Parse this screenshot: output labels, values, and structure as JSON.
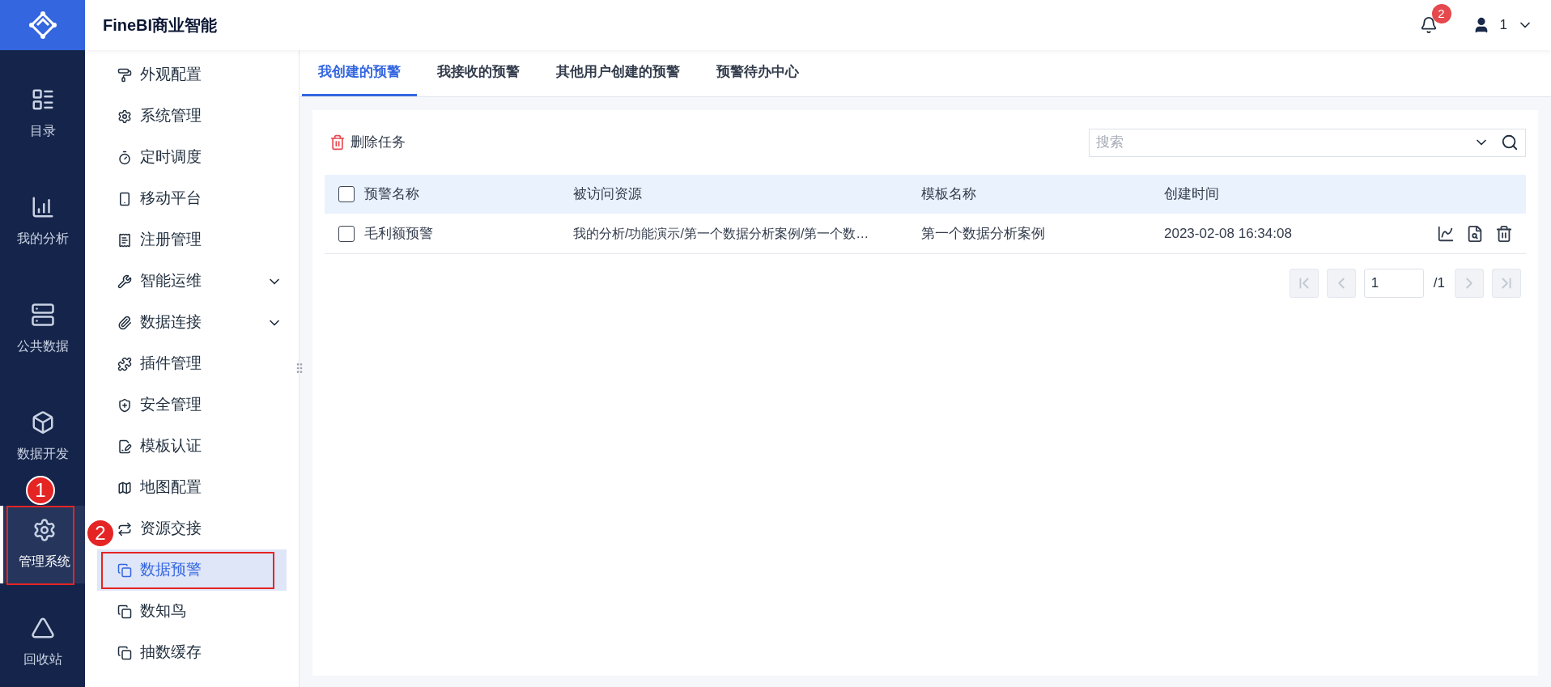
{
  "rail": {
    "items": [
      {
        "label": "目录",
        "selected": false
      },
      {
        "label": "我的分析",
        "selected": false
      },
      {
        "label": "公共数据",
        "selected": false
      },
      {
        "label": "数据开发",
        "selected": false
      },
      {
        "label": "管理系统",
        "selected": true,
        "callout": "1"
      },
      {
        "label": "回收站",
        "selected": false
      }
    ]
  },
  "header": {
    "title": "FineBI商业智能",
    "notifications": "2",
    "user": "1"
  },
  "sidebar": {
    "items": [
      {
        "label": "外观配置",
        "kind": "page",
        "selected": false
      },
      {
        "label": "系统管理",
        "kind": "page",
        "selected": false
      },
      {
        "label": "定时调度",
        "kind": "page",
        "selected": false
      },
      {
        "label": "移动平台",
        "kind": "page",
        "selected": false
      },
      {
        "label": "注册管理",
        "kind": "page",
        "selected": false
      },
      {
        "label": "智能运维",
        "kind": "group",
        "selected": false
      },
      {
        "label": "数据连接",
        "kind": "group",
        "selected": false
      },
      {
        "label": "插件管理",
        "kind": "page",
        "selected": false
      },
      {
        "label": "安全管理",
        "kind": "page",
        "selected": false
      },
      {
        "label": "模板认证",
        "kind": "page",
        "selected": false
      },
      {
        "label": "地图配置",
        "kind": "page",
        "selected": false
      },
      {
        "label": "资源交接",
        "kind": "page",
        "selected": false
      },
      {
        "label": "数据预警",
        "kind": "page",
        "selected": true,
        "callout": "2"
      },
      {
        "label": "数知鸟",
        "kind": "page",
        "selected": false
      },
      {
        "label": "抽数缓存",
        "kind": "page",
        "selected": false
      }
    ]
  },
  "tabs": [
    {
      "label": "我创建的预警",
      "selected": true
    },
    {
      "label": "我接收的预警",
      "selected": false
    },
    {
      "label": "其他用户创建的预警",
      "selected": false
    },
    {
      "label": "预警待办中心",
      "selected": false
    }
  ],
  "toolbar": {
    "delete": "删除任务",
    "search": {
      "placeholder": "搜索"
    }
  },
  "table": {
    "columns": [
      "预警名称",
      "被访问资源",
      "模板名称",
      "创建时间"
    ],
    "all_checked": false,
    "rows": [
      {
        "checked": false,
        "cells": [
          "毛利额预警",
          "我的分析/功能演示/第一个数据分析案例/第一个数…",
          "第一个数据分析案例",
          "2023-02-08 16:34:08"
        ]
      }
    ]
  },
  "pagination": {
    "page": "1",
    "total": "/1"
  }
}
